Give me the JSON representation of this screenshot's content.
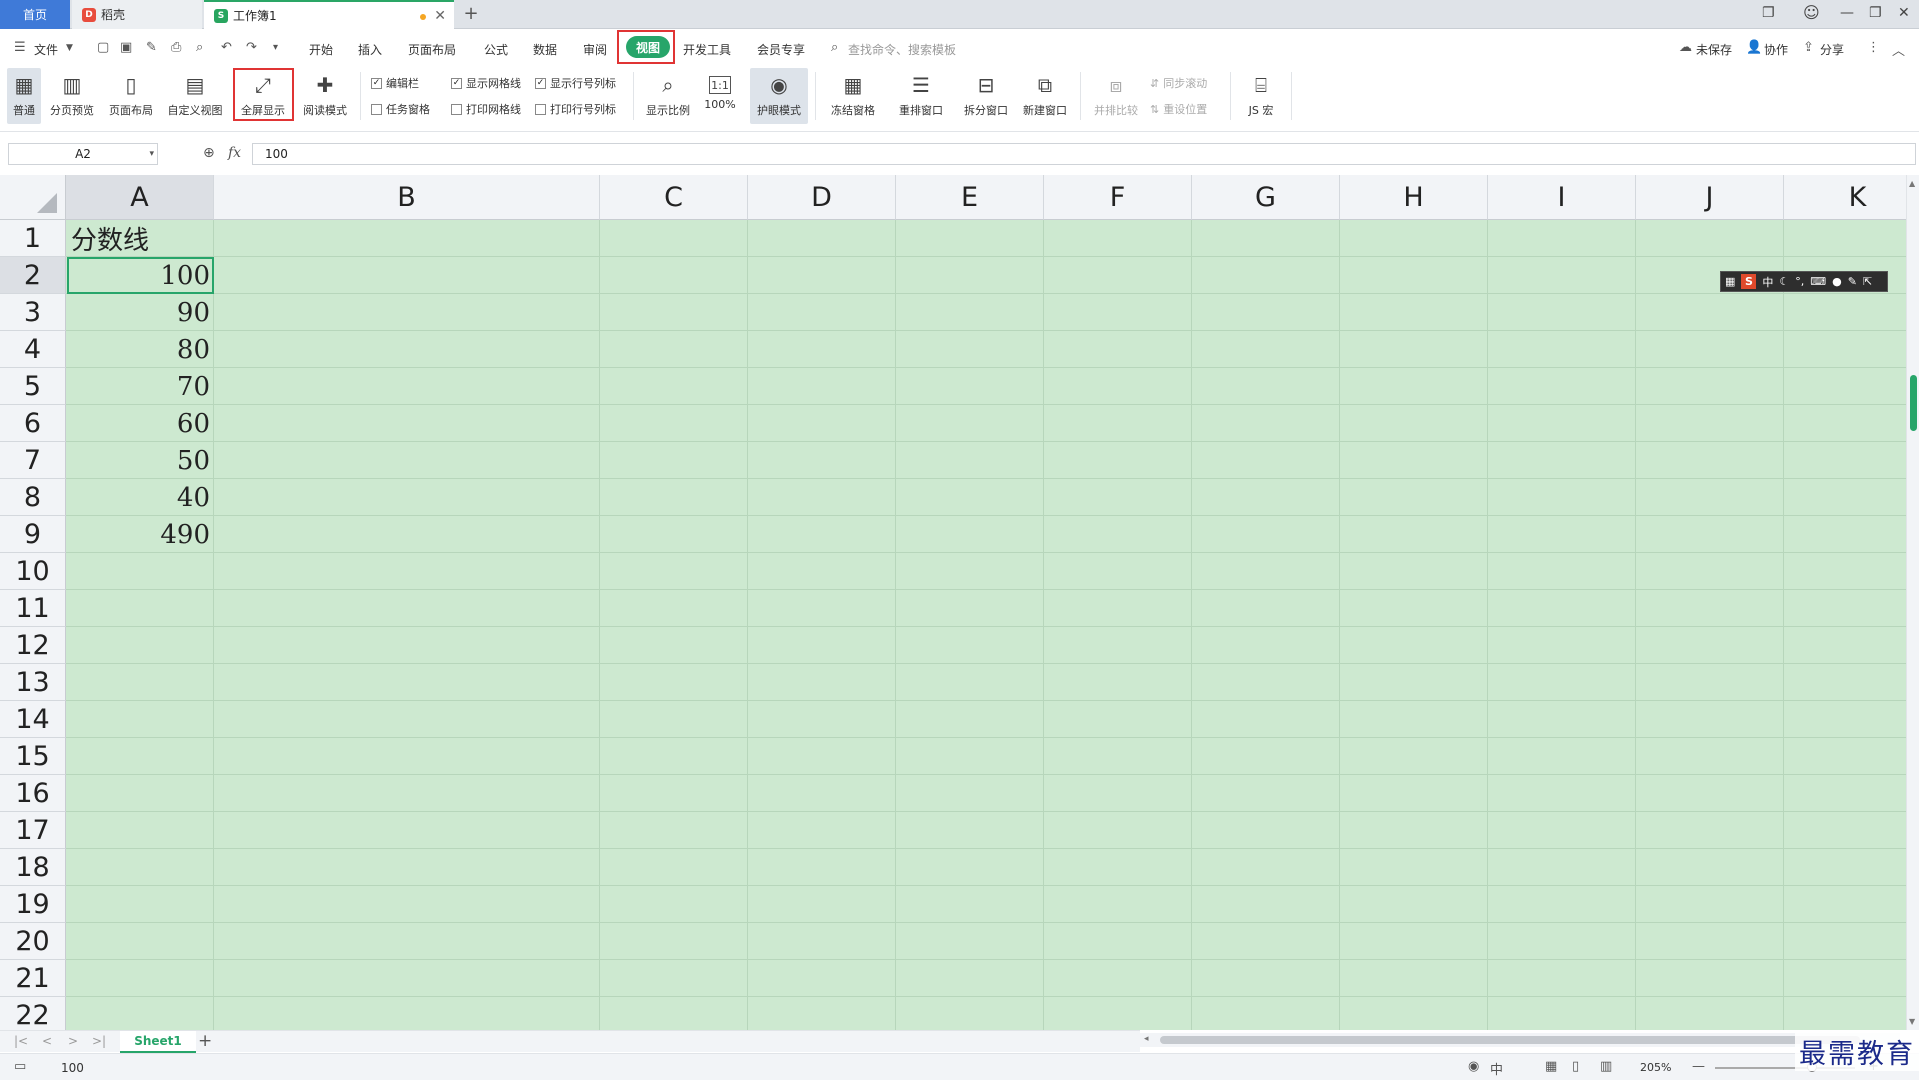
{
  "titlebar": {
    "tabs": [
      {
        "label": "首页"
      },
      {
        "label": "稻壳"
      },
      {
        "label": "工作簿1"
      }
    ]
  },
  "menu": {
    "file_label": "文件",
    "items": [
      "开始",
      "插入",
      "页面布局",
      "公式",
      "数据",
      "审阅",
      "视图",
      "开发工具",
      "会员专享"
    ],
    "active": "视图",
    "search_placeholder": "查找命令、搜索模板",
    "right": [
      "未保存",
      "协作",
      "分享"
    ]
  },
  "ribbon": {
    "buttons": [
      "普通",
      "分页预览",
      "页面布局",
      "自定义视图",
      "全屏显示",
      "阅读模式"
    ],
    "checkboxes": [
      {
        "label": "编辑栏",
        "checked": true
      },
      {
        "label": "显示网格线",
        "checked": true
      },
      {
        "label": "显示行号列标",
        "checked": true
      },
      {
        "label": "任务窗格",
        "checked": false
      },
      {
        "label": "打印网格线",
        "checked": false
      },
      {
        "label": "打印行号列标",
        "checked": false
      }
    ],
    "zoom_buttons": [
      "显示比例",
      "100%"
    ],
    "eye_mode": "护眼模式",
    "window_buttons": [
      "冻结窗格",
      "重排窗口",
      "拆分窗口",
      "新建窗口"
    ],
    "compare": [
      "并排比较",
      "同步滚动",
      "重设位置"
    ],
    "macro": "JS 宏"
  },
  "formula_bar": {
    "cell_ref": "A2",
    "fx_label": "fx",
    "value": "100"
  },
  "grid": {
    "columns": [
      "A",
      "B",
      "C",
      "D",
      "E",
      "F",
      "G",
      "H",
      "I",
      "J",
      "K"
    ],
    "rows": [
      "1",
      "2",
      "3",
      "4",
      "5",
      "6",
      "7",
      "8",
      "9",
      "10",
      "11",
      "12",
      "13",
      "14",
      "15",
      "16",
      "17",
      "18",
      "19",
      "20",
      "21",
      "22"
    ],
    "cells_A": [
      "分数线",
      "100",
      "90",
      "80",
      "70",
      "60",
      "50",
      "40",
      "490"
    ],
    "selected": "A2",
    "background_color": "#cde9d0",
    "selection_color": "#27a56a"
  },
  "ime": {
    "brand": "S",
    "mode": "中"
  },
  "sheet_tabs": {
    "tabs": [
      "Sheet1"
    ],
    "add": "+"
  },
  "statusbar": {
    "value": "100",
    "zoom": "205%"
  },
  "watermark": "最需教育"
}
